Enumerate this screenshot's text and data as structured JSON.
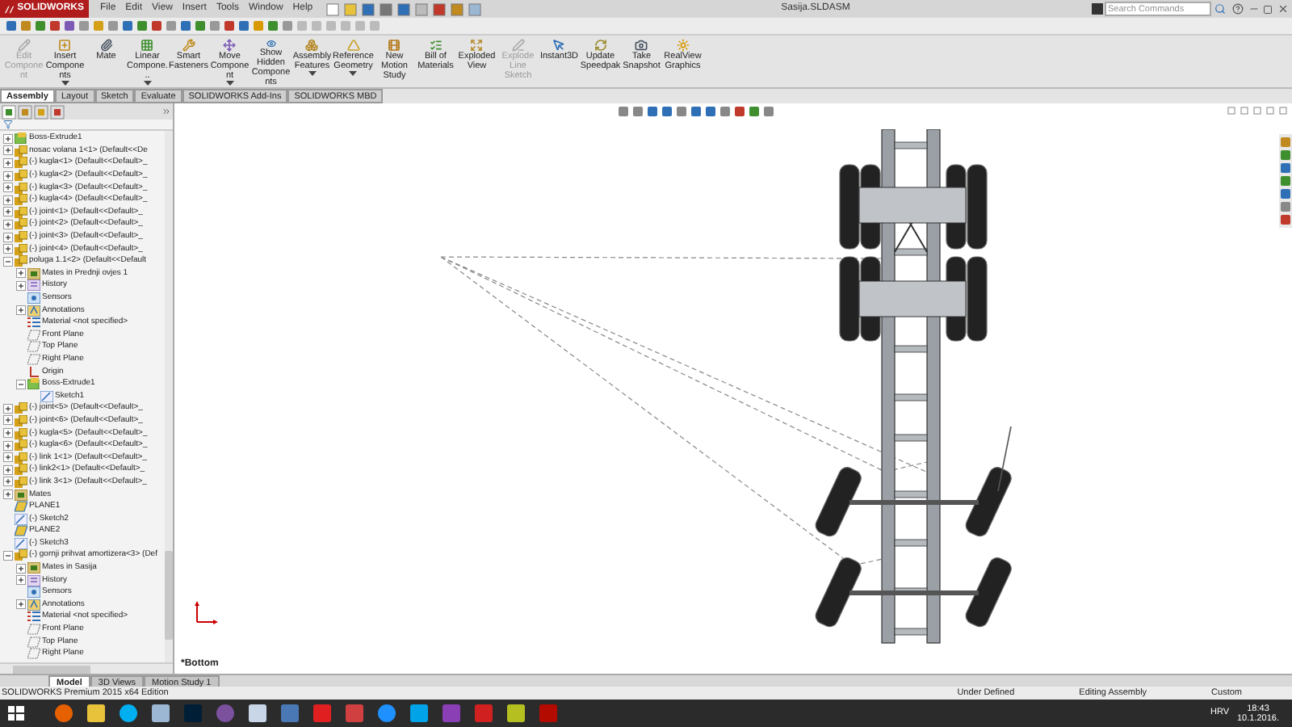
{
  "window": {
    "logo": "SOLIDWORKS",
    "title": "Sasija.SLDASM",
    "search": {
      "placeholder": "Search Commands"
    }
  },
  "menu": [
    "File",
    "Edit",
    "View",
    "Insert",
    "Tools",
    "Window",
    "Help"
  ],
  "commands": [
    {
      "label": "Edit Component",
      "disabled": true,
      "dropdown": false
    },
    {
      "label": "Insert Components",
      "disabled": false,
      "dropdown": true
    },
    {
      "label": "Mate",
      "disabled": false,
      "dropdown": false
    },
    {
      "label": "Linear Compone...",
      "disabled": false,
      "dropdown": true
    },
    {
      "label": "Smart Fasteners",
      "disabled": false,
      "dropdown": false
    },
    {
      "label": "Move Component",
      "disabled": false,
      "dropdown": true
    },
    {
      "label": "Show Hidden Components",
      "disabled": false,
      "dropdown": false
    },
    {
      "label": "Assembly Features",
      "disabled": false,
      "dropdown": true
    },
    {
      "label": "Reference Geometry",
      "disabled": false,
      "dropdown": true
    },
    {
      "label": "New Motion Study",
      "disabled": false,
      "dropdown": false
    },
    {
      "label": "Bill of Materials",
      "disabled": false,
      "dropdown": false
    },
    {
      "label": "Exploded View",
      "disabled": false,
      "dropdown": false
    },
    {
      "label": "Explode Line Sketch",
      "disabled": true,
      "dropdown": false
    },
    {
      "label": "Instant3D",
      "disabled": false,
      "dropdown": false
    },
    {
      "label": "Update Speedpak",
      "disabled": false,
      "dropdown": false
    },
    {
      "label": "Take Snapshot",
      "disabled": false,
      "dropdown": false
    },
    {
      "label": "RealView Graphics",
      "disabled": false,
      "dropdown": false
    }
  ],
  "tabs": [
    {
      "label": "Assembly",
      "selected": true
    },
    {
      "label": "Layout",
      "selected": false
    },
    {
      "label": "Sketch",
      "selected": false
    },
    {
      "label": "Evaluate",
      "selected": false
    },
    {
      "label": "SOLIDWORKS Add-Ins",
      "selected": false
    },
    {
      "label": "SOLIDWORKS MBD",
      "selected": false
    }
  ],
  "tree": [
    {
      "label": "Boss-Extrude1",
      "kind": "feature",
      "expanded": false
    },
    {
      "label": "nosac volana 1<1> (Default<<De",
      "kind": "part",
      "expanded": false
    },
    {
      "label": "(-) kugla<1> (Default<<Default>_",
      "kind": "part",
      "expanded": false
    },
    {
      "label": "(-) kugla<2> (Default<<Default>_",
      "kind": "part",
      "expanded": false
    },
    {
      "label": "(-) kugla<3> (Default<<Default>_",
      "kind": "part",
      "expanded": false
    },
    {
      "label": "(-) kugla<4> (Default<<Default>_",
      "kind": "part",
      "expanded": false
    },
    {
      "label": "(-) joint<1> (Default<<Default>_",
      "kind": "part",
      "expanded": false
    },
    {
      "label": "(-) joint<2> (Default<<Default>_",
      "kind": "part",
      "expanded": false
    },
    {
      "label": "(-) joint<3> (Default<<Default>_",
      "kind": "part",
      "expanded": false
    },
    {
      "label": "(-) joint<4> (Default<<Default>_",
      "kind": "part",
      "expanded": false
    },
    {
      "label": "poluga 1.1<2> (Default<<Default",
      "kind": "part",
      "expanded": true,
      "children": [
        {
          "label": "Mates in Prednji ovjes 1",
          "kind": "mates",
          "expanded": false
        },
        {
          "label": "History",
          "kind": "history",
          "expanded": false
        },
        {
          "label": "Sensors",
          "kind": "sensor"
        },
        {
          "label": "Annotations",
          "kind": "annotation",
          "expanded": false
        },
        {
          "label": "Material <not specified>",
          "kind": "material"
        },
        {
          "label": "Front Plane",
          "kind": "plane"
        },
        {
          "label": "Top Plane",
          "kind": "plane"
        },
        {
          "label": "Right Plane",
          "kind": "plane"
        },
        {
          "label": "Origin",
          "kind": "origin"
        },
        {
          "label": "Boss-Extrude1",
          "kind": "feature",
          "expanded": true,
          "children": [
            {
              "label": "Sketch1",
              "kind": "sketch"
            }
          ]
        }
      ]
    },
    {
      "label": "(-) joint<5> (Default<<Default>_",
      "kind": "part",
      "expanded": false
    },
    {
      "label": "(-) joint<6> (Default<<Default>_",
      "kind": "part",
      "expanded": false
    },
    {
      "label": "(-) kugla<5> (Default<<Default>_",
      "kind": "part",
      "expanded": false
    },
    {
      "label": "(-) kugla<6> (Default<<Default>_",
      "kind": "part",
      "expanded": false
    },
    {
      "label": "(-) link 1<1> (Default<<Default>_",
      "kind": "part",
      "expanded": false
    },
    {
      "label": "(-) link2<1> (Default<<Default>_",
      "kind": "part",
      "expanded": false
    },
    {
      "label": "(-) link 3<1> (Default<<Default>_",
      "kind": "part",
      "expanded": false
    },
    {
      "label": "Mates",
      "kind": "mates",
      "expanded": false
    },
    {
      "label": "PLANE1",
      "kind": "plane-yellow"
    },
    {
      "label": "(-) Sketch2",
      "kind": "sketch"
    },
    {
      "label": "PLANE2",
      "kind": "plane-yellow"
    },
    {
      "label": "(-) Sketch3",
      "kind": "sketch"
    },
    {
      "label": "(-) gornji prihvat amortizera<3> (Def",
      "kind": "part",
      "expanded": true,
      "children": [
        {
          "label": "Mates in Sasija",
          "kind": "mates",
          "expanded": false
        },
        {
          "label": "History",
          "kind": "history",
          "expanded": false
        },
        {
          "label": "Sensors",
          "kind": "sensor"
        },
        {
          "label": "Annotations",
          "kind": "annotation",
          "expanded": false
        },
        {
          "label": "Material <not specified>",
          "kind": "material"
        },
        {
          "label": "Front Plane",
          "kind": "plane"
        },
        {
          "label": "Top Plane",
          "kind": "plane"
        },
        {
          "label": "Right Plane",
          "kind": "plane"
        }
      ]
    }
  ],
  "view": {
    "label": "*Bottom"
  },
  "bottom_tabs": [
    {
      "label": "Model",
      "selected": true
    },
    {
      "label": "3D Views",
      "selected": false
    },
    {
      "label": "Motion Study 1",
      "selected": false
    }
  ],
  "status_bar": {
    "product": "SOLIDWORKS Premium 2015 x64 Edition",
    "items": [
      "Under Defined",
      "Editing Assembly",
      "Custom"
    ]
  },
  "taskbar": {
    "language": "HRV",
    "time": "18:43",
    "date": "10.1.2016."
  }
}
